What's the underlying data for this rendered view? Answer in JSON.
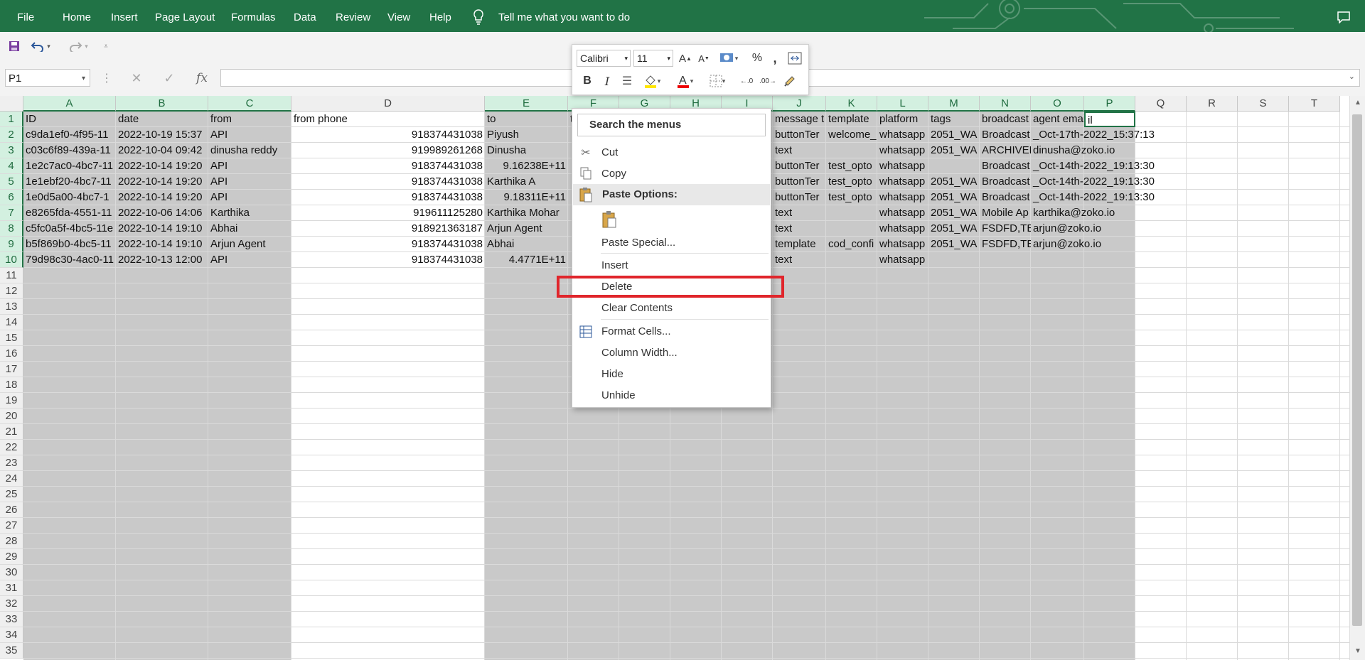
{
  "ribbon": {
    "tabs": [
      "File",
      "Home",
      "Insert",
      "Page Layout",
      "Formulas",
      "Data",
      "Review",
      "View",
      "Help"
    ],
    "tell_me": "Tell me what you want to do",
    "bg": "#217346"
  },
  "formula_bar": {
    "name_box": "P1",
    "fx": "fx",
    "value": ""
  },
  "columns": [
    "A",
    "B",
    "C",
    "D",
    "E",
    "F",
    "G",
    "H",
    "I",
    "J",
    "K",
    "L",
    "M",
    "N",
    "O",
    "P",
    "Q",
    "R",
    "S",
    "T"
  ],
  "rows": [
    "1",
    "2",
    "3",
    "4",
    "5",
    "6",
    "7",
    "8",
    "9",
    "10",
    "11",
    "12",
    "13",
    "14",
    "15",
    "16",
    "17",
    "18",
    "19",
    "20",
    "21",
    "22",
    "23",
    "24",
    "25",
    "26",
    "27",
    "28",
    "29",
    "30",
    "31",
    "32",
    "33",
    "34",
    "35"
  ],
  "cells": {
    "r1": [
      "ID",
      "date",
      "from",
      "from phone",
      "to",
      "t",
      "",
      "",
      "",
      "message t",
      "template",
      "platform",
      "tags",
      "broadcast",
      "agent email",
      "il"
    ],
    "r2": [
      "c9da1ef0-4f95-11",
      "2022-10-19 15:37",
      "API",
      "918374431038",
      "Piyush",
      "",
      "",
      "",
      "",
      "buttonTer",
      "welcome_",
      "whatsapp",
      "2051_WA",
      "Broadcast",
      "_Oct-17th-2022_15:37:13",
      ""
    ],
    "r3": [
      "c03c6f89-439a-11",
      "2022-10-04 09:42",
      "dinusha reddy",
      "919989261268",
      "Dinusha",
      "",
      "",
      "",
      "",
      "text",
      "",
      "whatsapp",
      "2051_WA",
      "ARCHIVED",
      "dinusha@zoko.io",
      ""
    ],
    "r4": [
      "1e2c7ac0-4bc7-11",
      "2022-10-14 19:20",
      "API",
      "918374431038",
      "9.16238E+11",
      "",
      "",
      "",
      "",
      "buttonTer",
      "test_opto",
      "whatsapp",
      "",
      "Broadcast",
      "_Oct-14th-2022_19:13:30",
      ""
    ],
    "r5": [
      "1e1ebf20-4bc7-11",
      "2022-10-14 19:20",
      "API",
      "918374431038",
      "Karthika A",
      "",
      "",
      "",
      "",
      "buttonTer",
      "test_opto",
      "whatsapp",
      "2051_WA",
      "Broadcast",
      "_Oct-14th-2022_19:13:30",
      ""
    ],
    "r6": [
      "1e0d5a00-4bc7-1",
      "2022-10-14 19:20",
      "API",
      "918374431038",
      "9.18311E+11",
      "",
      "",
      "",
      "",
      "buttonTer",
      "test_opto",
      "whatsapp",
      "2051_WA",
      "Broadcast",
      "_Oct-14th-2022_19:13:30",
      ""
    ],
    "r7": [
      "e8265fda-4551-11",
      "2022-10-06 14:06",
      "Karthika",
      "919611125280",
      "Karthika Mohar",
      "",
      "",
      "",
      "",
      "text",
      "",
      "whatsapp",
      "2051_WA",
      "Mobile Ap",
      "karthika@zoko.io",
      ""
    ],
    "r8": [
      "c5fc0a5f-4bc5-11e",
      "2022-10-14 19:10",
      "Abhai",
      "918921363187",
      "Arjun Agent",
      "",
      "",
      "",
      "",
      "text",
      "",
      "whatsapp",
      "2051_WA",
      "FSDFD,TES",
      "arjun@zoko.io",
      ""
    ],
    "r9": [
      "b5f869b0-4bc5-11",
      "2022-10-14 19:10",
      "Arjun Agent",
      "918374431038",
      "Abhai",
      "",
      "",
      "",
      "",
      "template",
      "cod_confi",
      "whatsapp",
      "2051_WA",
      "FSDFD,TES",
      "arjun@zoko.io",
      ""
    ],
    "r10": [
      "79d98c30-4ac0-11",
      "2022-10-13 12:00",
      "API",
      "918374431038",
      "4.4771E+11",
      "",
      "",
      "",
      "",
      "text",
      "",
      "whatsapp",
      "",
      "",
      "",
      ""
    ]
  },
  "mini_toolbar": {
    "font": "Calibri",
    "size": "11",
    "bold": "B",
    "italic": "I",
    "percent": "%",
    "comma": ","
  },
  "context_menu": {
    "search_placeholder": "Search the menus",
    "items": {
      "cut": "Cut",
      "copy": "Copy",
      "paste_options": "Paste Options:",
      "paste_special": "Paste Special...",
      "insert": "Insert",
      "delete": "Delete",
      "clear_contents": "Clear Contents",
      "format_cells": "Format Cells...",
      "column_width": "Column Width...",
      "hide": "Hide",
      "unhide": "Unhide"
    }
  },
  "colors": {
    "accent": "#217346",
    "selection": "#c9c9c9",
    "highlight": "#e0252b"
  }
}
